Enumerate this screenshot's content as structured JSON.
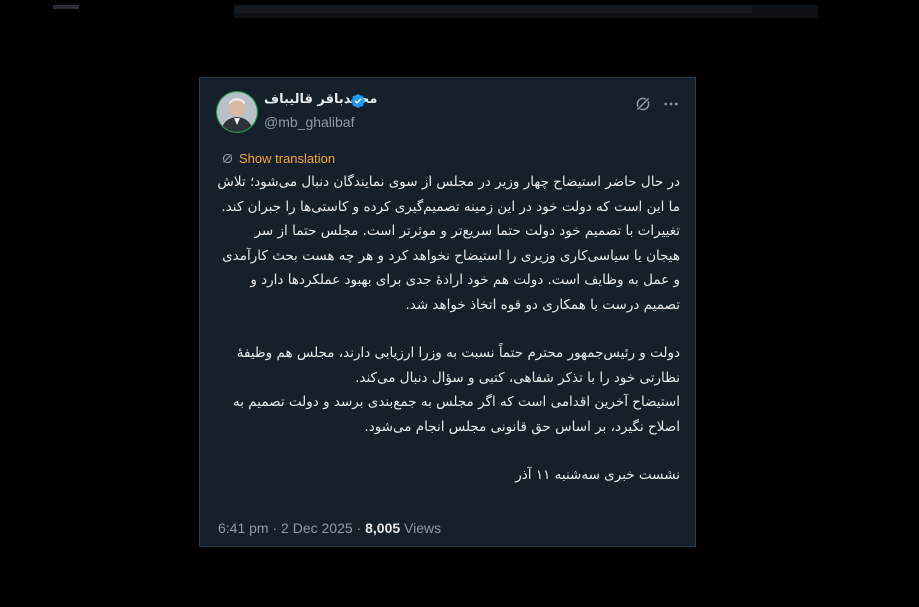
{
  "tweet": {
    "author_name": "محمدباقر قالیباف",
    "author_handle": "@mb_ghalibaf",
    "show_translation_label": "Show translation",
    "paragraph1": "در حال حاضر استیضاح چهار وزیر در مجلس از سوی نمایندگان دنبال می‌شود؛ تلاش ما این است که دولت خود در این زمینه تصمیم‌گیری کرده و کاستی‌ها را جبران کند. تغییرات با تصمیم خود دولت حتما سریع‌تر و موثرتر است. مجلس حتما از سر هیجان یا سیاسی‌کاری وزیری را استیضاح نخواهد کرد و هر چه هست بحث کارآمدی و عمل به وظایف است. دولت هم خود ارادهٔ جدی برای بهبود عملکردها دارد و تصمیم درست با همکاری دو قوه اتخاذ خواهد شد.",
    "paragraph2": "دولت و رئیس‌جمهور محترم حتماً نسبت به وزرا ارزیابی دارند، مجلس هم وظیفهٔ نظارتی خود را با تذکر شفاهی، کتبی و سؤال دنبال می‌کند.",
    "paragraph3": "استیضاح آخرین اقدامی است که اگر مجلس به جمع‌بندی برسد و دولت تصمیم به اصلاح نگیرد، بر اساس حق قانونی مجلس انجام می‌شود.",
    "paragraph4": "نشست خبری سه‌شنبه ۱۱ آذر",
    "time": "6:41 pm",
    "date": "2 Dec 2025",
    "separator": "·",
    "views_count": "8,005",
    "views_label": "Views"
  },
  "icons": {
    "verified": "verified-badge-icon",
    "grok": "grok-icon",
    "more": "more-options-icon",
    "translate": "translate-icon"
  },
  "colors": {
    "card_background": "#15202b",
    "text_primary": "#e7e9ea",
    "text_secondary": "#8b98a5",
    "verified_blue": "#1d9bf0",
    "translation_accent": "#f4a72c"
  }
}
